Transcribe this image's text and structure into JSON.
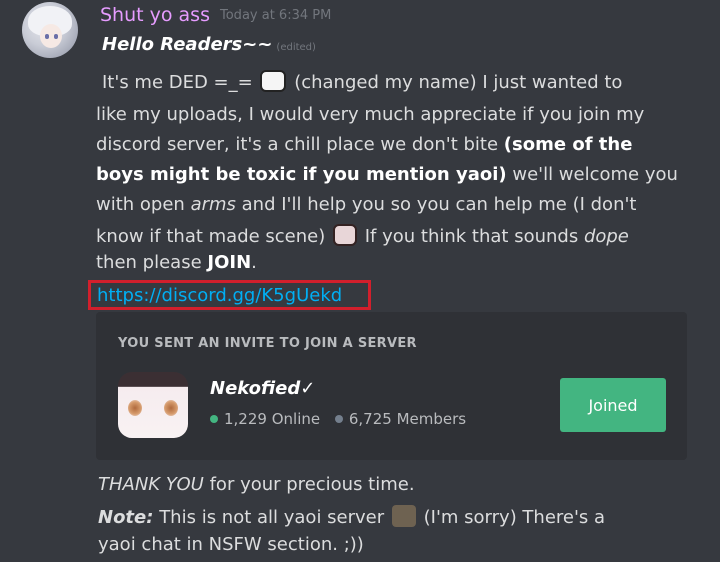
{
  "message": {
    "username": "Shut yo ass",
    "timestamp": "Today at 6:34 PM",
    "title": "Hello Readers~~",
    "edited": "(edited)",
    "lines": {
      "l1a": "It's me DED =_=",
      "l1b": "(changed my name)  I just wanted to",
      "l2": "like my uploads, I would very much appreciate if you join my",
      "l3": "discord server, it's a chill place we don't bite",
      "l3b": "(some of the",
      "l4b": "boys might be toxic if you mention yaoi)",
      "l4": "we'll welcome you",
      "l5a": "with open",
      "l5i": "arms",
      "l5b": "and I'll help you so you can help me (I don't",
      "l6a": "know if that made scene)",
      "l6b": "If you think that sounds",
      "l6i": "dope",
      "l7a": "then please",
      "l7b": "JOIN",
      "l7c": "."
    },
    "link": "https://discord.gg/K5gUekd",
    "after": {
      "thanks_i": "THANK YOU",
      "thanks": "for your precious time.",
      "note_label": "Note:",
      "note_a": "This is not all yaoi server",
      "note_b": "(I'm sorry) There's a",
      "note_c": "yaoi chat in NSFW section. ;))"
    }
  },
  "invite": {
    "header": "YOU SENT AN INVITE TO JOIN A SERVER",
    "server_name": "Nekofied✓",
    "online": "1,229 Online",
    "members": "6,725 Members",
    "button": "Joined"
  },
  "colors": {
    "background": "#36393f",
    "username": "#e69cff",
    "link": "#00aff4",
    "highlight_box": "#d21f2c",
    "joined_button": "#43b581",
    "online_dot": "#43b581"
  },
  "icons": [
    "avatar",
    "cat-emoji",
    "blushing-cat-emoji",
    "kitten-photo-emoji",
    "server-icon"
  ]
}
